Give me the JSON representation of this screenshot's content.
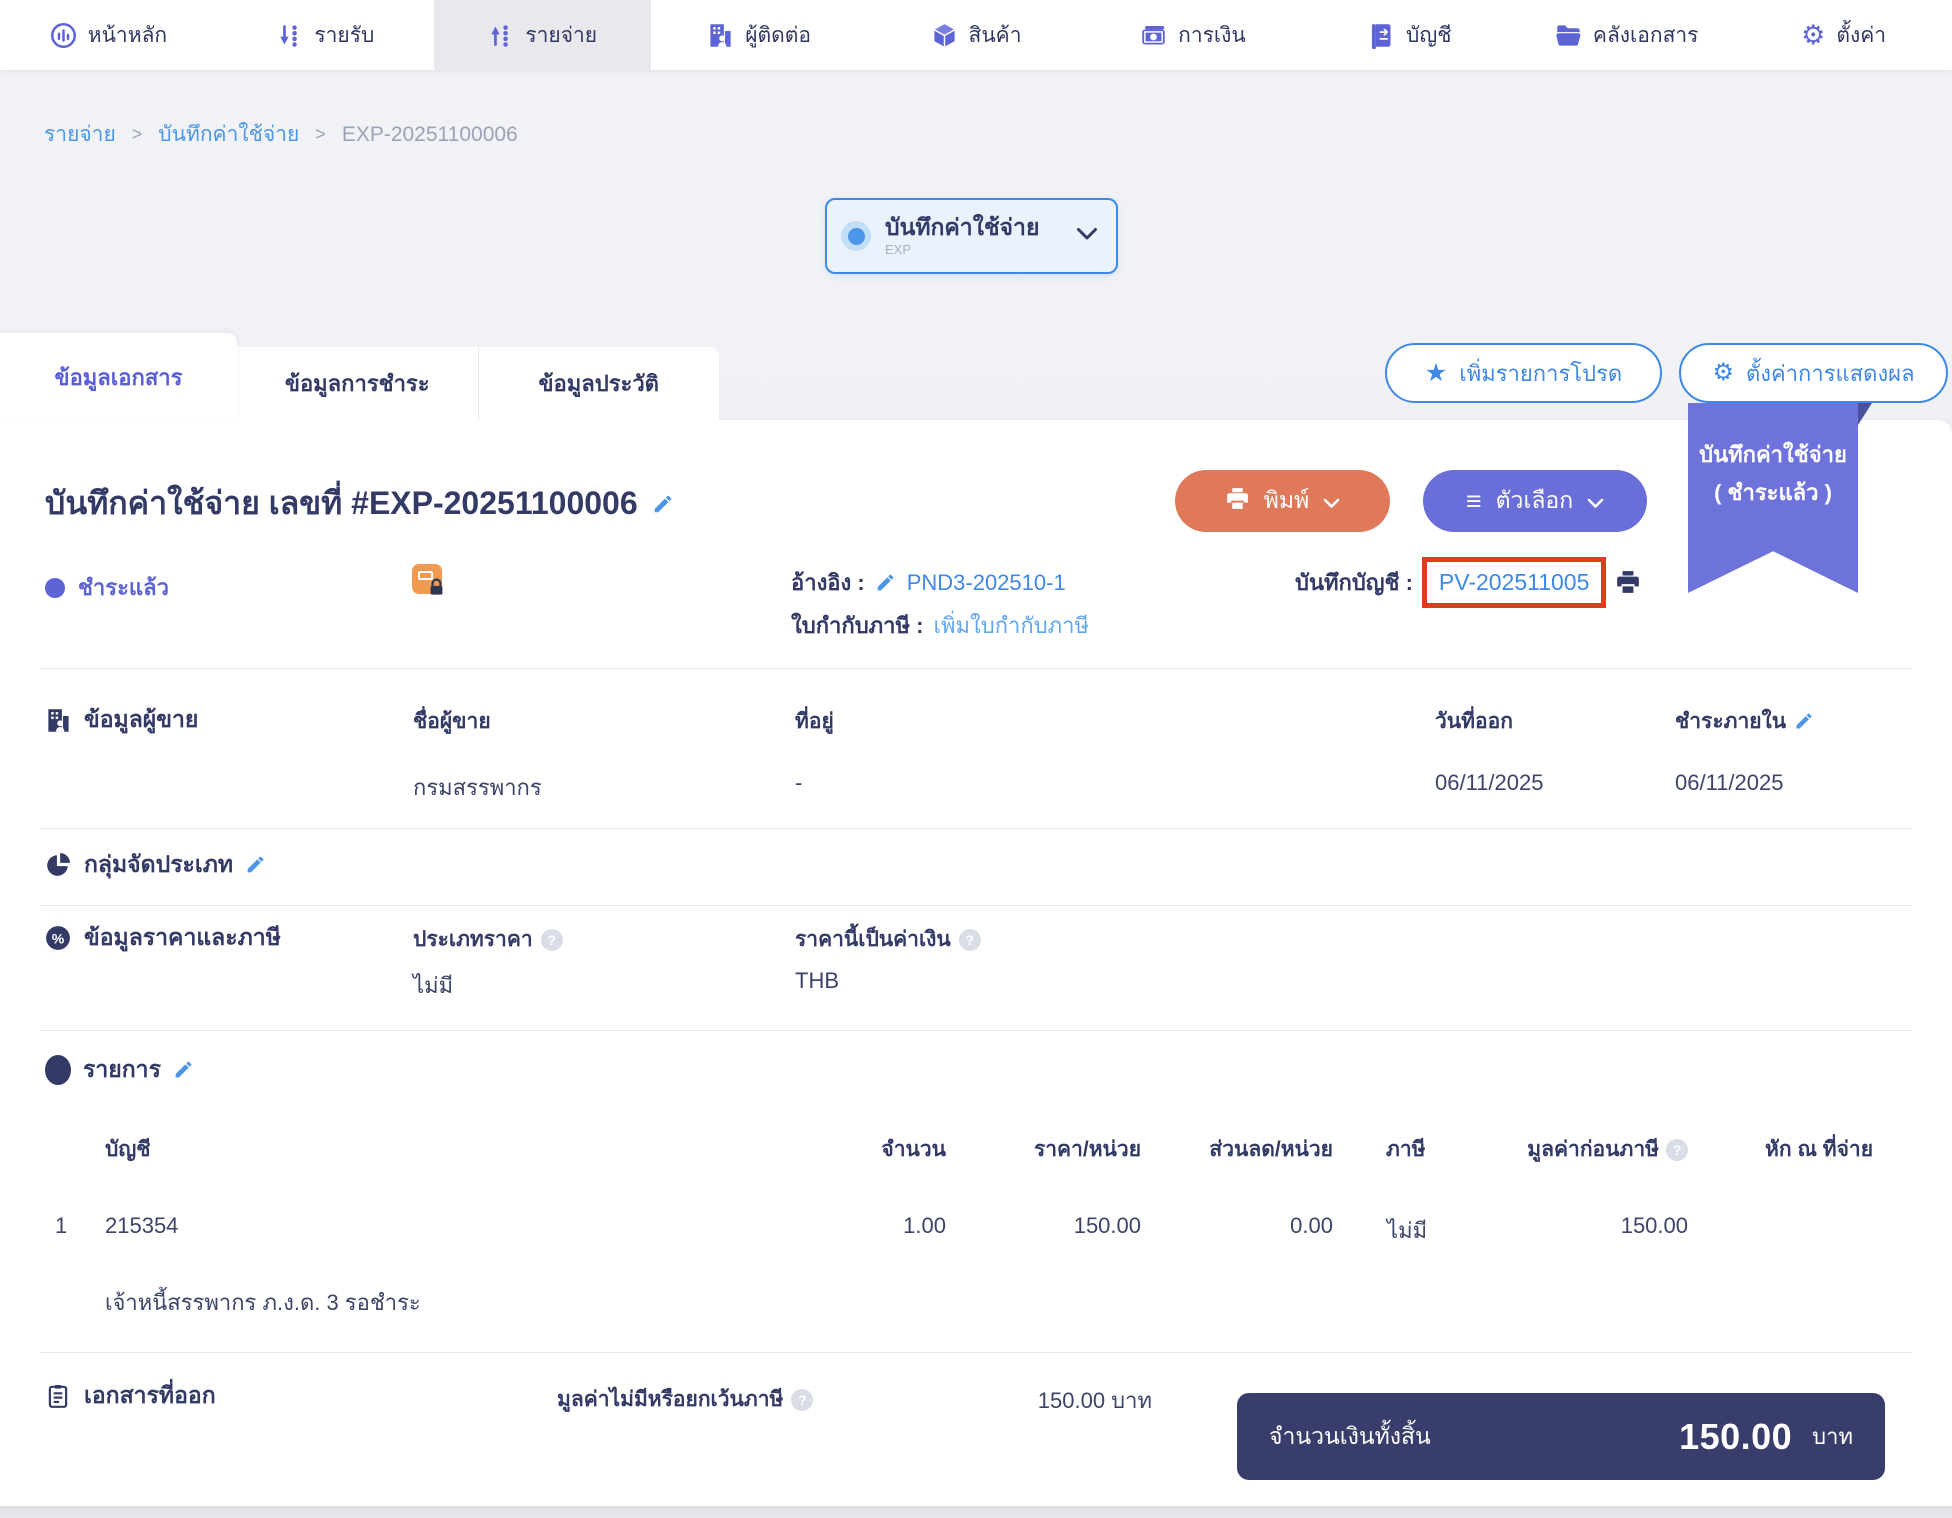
{
  "ui": {
    "help_glyph": "?",
    "star_glyph": "★",
    "gear_glyph": "⚙",
    "menu_glyph": "≡",
    "breadcrumb_separator": ">"
  },
  "colors": {
    "accent_blue": "#3f88e8",
    "indigo": "#5e63d6",
    "orange_button": "#e0795a",
    "purple_button": "#696ed9",
    "ribbon_purple": "#6e73dc",
    "navy_text": "#333a66",
    "red_highlight": "#e23a1c",
    "total_box_bg": "#383d6b",
    "status_color": "#5e63d6"
  },
  "nav": {
    "items": [
      {
        "label": "หน้าหลัก",
        "active": false
      },
      {
        "label": "รายรับ",
        "active": false
      },
      {
        "label": "รายจ่าย",
        "active": true
      },
      {
        "label": "ผู้ติดต่อ",
        "active": false
      },
      {
        "label": "สินค้า",
        "active": false
      },
      {
        "label": "การเงิน",
        "active": false
      },
      {
        "label": "บัญชี",
        "active": false
      },
      {
        "label": "คลังเอกสาร",
        "active": false
      },
      {
        "label": "ตั้งค่า",
        "active": false
      }
    ]
  },
  "breadcrumb": {
    "items": [
      "รายจ่าย",
      "บันทึกค่าใช้จ่าย",
      "EXP-20251100006"
    ]
  },
  "doc_selector": {
    "title": "บันทึกค่าใช้จ่าย",
    "code": "EXP"
  },
  "tabs": [
    {
      "label": "ข้อมูลเอกสาร",
      "active": true
    },
    {
      "label": "ข้อมูลการชำระ",
      "active": false
    },
    {
      "label": "ข้อมูลประวัติ",
      "active": false
    }
  ],
  "actions": {
    "favorite_label": "เพิ่มรายการโปรด",
    "display_settings_label": "ตั้งค่าการแสดงผล"
  },
  "ribbon": {
    "line1": "บันทึกค่าใช้จ่าย",
    "line2": "( ชำระแล้ว )"
  },
  "doc": {
    "title": "บันทึกค่าใช้จ่าย เลขที่ #EXP-20251100006",
    "print_label": "พิมพ์",
    "options_label": "ตัวเลือก",
    "status": "ชำระแล้ว",
    "reference_label": "อ้างอิง :",
    "reference_value": "PND3-202510-1",
    "tax_invoice_label": "ใบกำกับภาษี :",
    "tax_invoice_action": "เพิ่มใบกำกับภาษี",
    "journal_label": "บันทึกบัญชี :",
    "journal_value": "PV-202511005"
  },
  "seller": {
    "section_title": "ข้อมูลผู้ขาย",
    "name_label": "ชื่อผู้ขาย",
    "name_value": "กรมสรรพากร",
    "address_label": "ที่อยู่",
    "address_value": "-",
    "issue_date_label": "วันที่ออก",
    "issue_date_value": "06/11/2025",
    "due_label": "ชำระภายใน",
    "due_value": "06/11/2025"
  },
  "classification": {
    "section_title": "กลุ่มจัดประเภท"
  },
  "pricing": {
    "section_title": "ข้อมูลราคาและภาษี",
    "price_type_label": "ประเภทราคา",
    "price_type_value": "ไม่มี",
    "currency_label": "ราคานี้เป็นค่าเงิน",
    "currency_value": "THB"
  },
  "items": {
    "section_title": "รายการ",
    "columns": [
      "บัญชี",
      "จำนวน",
      "ราคา/หน่วย",
      "ส่วนลด/หน่วย",
      "ภาษี",
      "มูลค่าก่อนภาษี",
      "หัก ณ ที่จ่าย"
    ],
    "rows": [
      {
        "no": "1",
        "account": "215354",
        "qty": "1.00",
        "price_per_unit": "150.00",
        "discount_per_unit": "0.00",
        "tax": "ไม่มี",
        "pretax_value": "150.00",
        "withholding": "",
        "description": "เจ้าหนี้สรรพากร ภ.ง.ด. 3 รอชำระ"
      }
    ]
  },
  "footer": {
    "section_title": "เอกสารที่ออก",
    "exempt_label": "มูลค่าไม่มีหรือยกเว้นภาษี",
    "exempt_value": "150.00 บาท",
    "total_label": "จำนวนเงินทั้งสิ้น",
    "total_value": "150.00",
    "total_unit": "บาท"
  }
}
